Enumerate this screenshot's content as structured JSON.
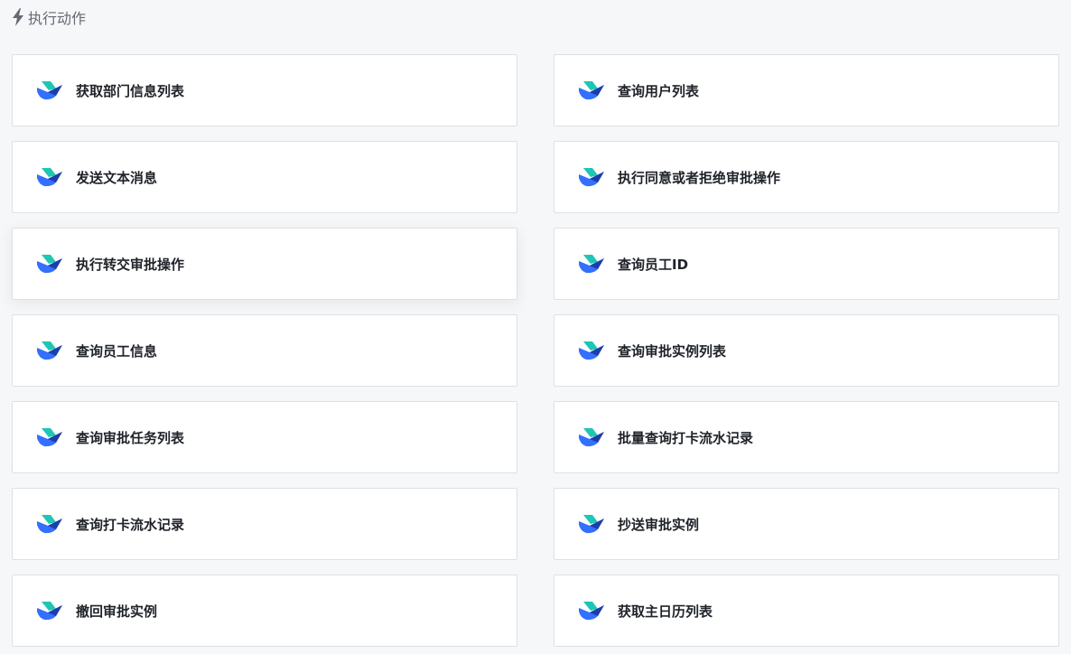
{
  "section": {
    "title": "执行动作",
    "icon": "lightning-bolt-icon"
  },
  "actions": [
    {
      "label": "获取部门信息列表",
      "icon": "feishu-logo-icon"
    },
    {
      "label": "查询用户列表",
      "icon": "feishu-logo-icon"
    },
    {
      "label": "发送文本消息",
      "icon": "feishu-logo-icon"
    },
    {
      "label": "执行同意或者拒绝审批操作",
      "icon": "feishu-logo-icon"
    },
    {
      "label": "执行转交审批操作",
      "icon": "feishu-logo-icon"
    },
    {
      "label": "查询员工ID",
      "icon": "feishu-logo-icon"
    },
    {
      "label": "查询员工信息",
      "icon": "feishu-logo-icon"
    },
    {
      "label": "查询审批实例列表",
      "icon": "feishu-logo-icon"
    },
    {
      "label": "查询审批任务列表",
      "icon": "feishu-logo-icon"
    },
    {
      "label": "批量查询打卡流水记录",
      "icon": "feishu-logo-icon"
    },
    {
      "label": "查询打卡流水记录",
      "icon": "feishu-logo-icon"
    },
    {
      "label": "抄送审批实例",
      "icon": "feishu-logo-icon"
    },
    {
      "label": "撤回审批实例",
      "icon": "feishu-logo-icon"
    },
    {
      "label": "获取主日历列表",
      "icon": "feishu-logo-icon"
    }
  ],
  "colors": {
    "background": "#f6f7f9",
    "card_border": "#dee0e3",
    "logo_teal": "#1ec6b4",
    "logo_blue": "#3370ff",
    "logo_navy": "#1d3ea8",
    "header_text": "#646a73"
  }
}
